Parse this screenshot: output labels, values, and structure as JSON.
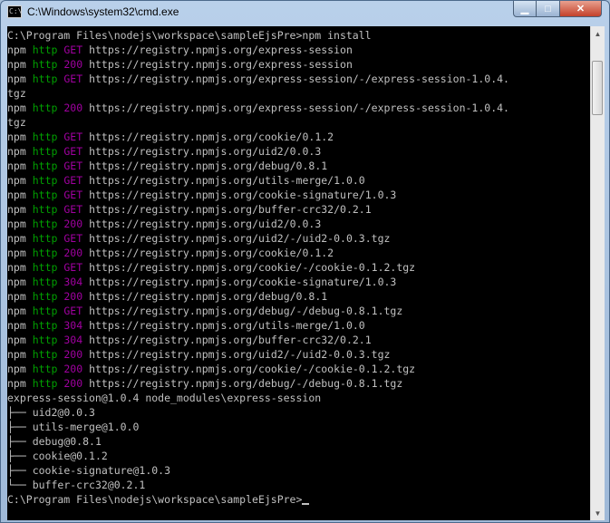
{
  "window": {
    "title": "C:\\Windows\\system32\\cmd.exe",
    "icon": "cmd-icon"
  },
  "controls": {
    "minimize": "minimize-icon",
    "maximize": "maximize-icon",
    "close": "close-icon"
  },
  "colors": {
    "console_bg": "#000000",
    "text": "#c0c0c0",
    "http": "#00a000",
    "status": "#a000a0"
  },
  "prompt_path": "C:\\Program Files\\nodejs\\workspace\\sampleEjsPre>",
  "command": "npm install",
  "log": [
    {
      "p": "npm",
      "h": "http",
      "s": "GET",
      "u": "https://registry.npmjs.org/express-session"
    },
    {
      "p": "npm",
      "h": "http",
      "s": "200",
      "u": "https://registry.npmjs.org/express-session"
    },
    {
      "p": "npm",
      "h": "http",
      "s": "GET",
      "u": "https://registry.npmjs.org/express-session/-/express-session-1.0.4.",
      "c": "tgz"
    },
    {
      "p": "npm",
      "h": "http",
      "s": "200",
      "u": "https://registry.npmjs.org/express-session/-/express-session-1.0.4.",
      "c": "tgz"
    },
    {
      "p": "npm",
      "h": "http",
      "s": "GET",
      "u": "https://registry.npmjs.org/cookie/0.1.2"
    },
    {
      "p": "npm",
      "h": "http",
      "s": "GET",
      "u": "https://registry.npmjs.org/uid2/0.0.3"
    },
    {
      "p": "npm",
      "h": "http",
      "s": "GET",
      "u": "https://registry.npmjs.org/debug/0.8.1"
    },
    {
      "p": "npm",
      "h": "http",
      "s": "GET",
      "u": "https://registry.npmjs.org/utils-merge/1.0.0"
    },
    {
      "p": "npm",
      "h": "http",
      "s": "GET",
      "u": "https://registry.npmjs.org/cookie-signature/1.0.3"
    },
    {
      "p": "npm",
      "h": "http",
      "s": "GET",
      "u": "https://registry.npmjs.org/buffer-crc32/0.2.1"
    },
    {
      "p": "npm",
      "h": "http",
      "s": "200",
      "u": "https://registry.npmjs.org/uid2/0.0.3"
    },
    {
      "p": "npm",
      "h": "http",
      "s": "GET",
      "u": "https://registry.npmjs.org/uid2/-/uid2-0.0.3.tgz"
    },
    {
      "p": "npm",
      "h": "http",
      "s": "200",
      "u": "https://registry.npmjs.org/cookie/0.1.2"
    },
    {
      "p": "npm",
      "h": "http",
      "s": "GET",
      "u": "https://registry.npmjs.org/cookie/-/cookie-0.1.2.tgz"
    },
    {
      "p": "npm",
      "h": "http",
      "s": "304",
      "u": "https://registry.npmjs.org/cookie-signature/1.0.3"
    },
    {
      "p": "npm",
      "h": "http",
      "s": "200",
      "u": "https://registry.npmjs.org/debug/0.8.1"
    },
    {
      "p": "npm",
      "h": "http",
      "s": "GET",
      "u": "https://registry.npmjs.org/debug/-/debug-0.8.1.tgz"
    },
    {
      "p": "npm",
      "h": "http",
      "s": "304",
      "u": "https://registry.npmjs.org/utils-merge/1.0.0"
    },
    {
      "p": "npm",
      "h": "http",
      "s": "304",
      "u": "https://registry.npmjs.org/buffer-crc32/0.2.1"
    },
    {
      "p": "npm",
      "h": "http",
      "s": "200",
      "u": "https://registry.npmjs.org/uid2/-/uid2-0.0.3.tgz"
    },
    {
      "p": "npm",
      "h": "http",
      "s": "200",
      "u": "https://registry.npmjs.org/cookie/-/cookie-0.1.2.tgz"
    },
    {
      "p": "npm",
      "h": "http",
      "s": "200",
      "u": "https://registry.npmjs.org/debug/-/debug-0.8.1.tgz"
    }
  ],
  "summary": "express-session@1.0.4 node_modules\\express-session",
  "tree": [
    {
      "b": "├── ",
      "t": "uid2@0.0.3"
    },
    {
      "b": "├── ",
      "t": "utils-merge@1.0.0"
    },
    {
      "b": "├── ",
      "t": "debug@0.8.1"
    },
    {
      "b": "├── ",
      "t": "cookie@0.1.2"
    },
    {
      "b": "├── ",
      "t": "cookie-signature@1.0.3"
    },
    {
      "b": "└── ",
      "t": "buffer-crc32@0.2.1"
    }
  ],
  "scrollbar": {
    "up": "scroll-up-arrow-icon",
    "down": "scroll-down-arrow-icon"
  }
}
